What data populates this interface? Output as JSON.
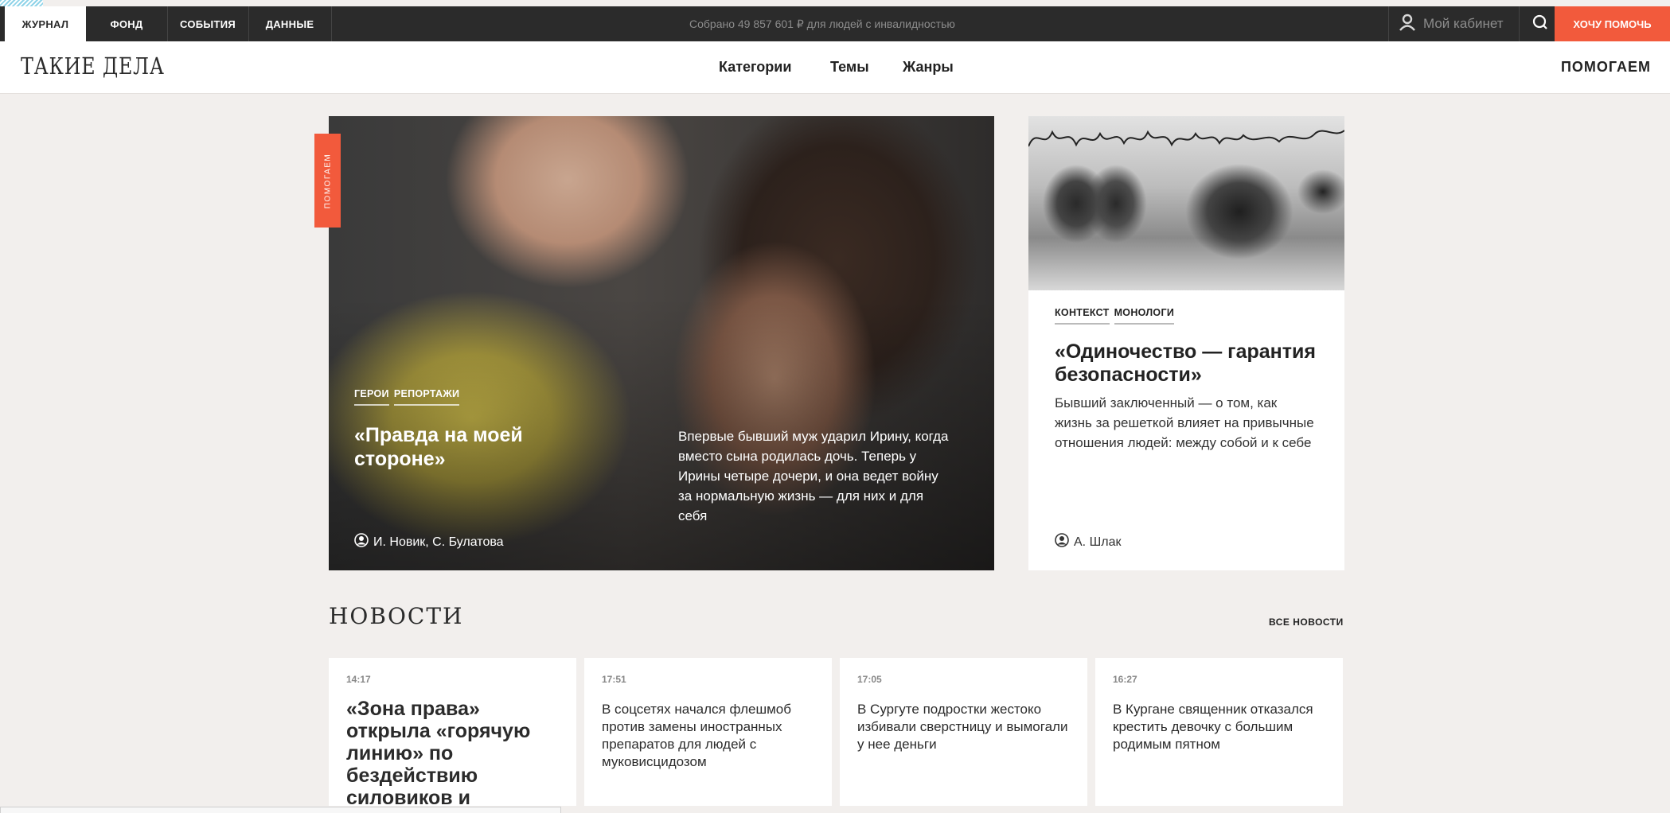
{
  "topbar": {
    "tabs": [
      {
        "label": "ЖУРНАЛ"
      },
      {
        "label": "ФОНД"
      },
      {
        "label": "СОБЫТИЯ"
      },
      {
        "label": "ДАННЫЕ"
      }
    ],
    "collected": "Собрано 49 857 601 ₽ для людей с инвалидностью",
    "cabinet": "Мой кабинет",
    "help_button": "ХОЧУ ПОМОЧЬ",
    "accent_color": "#f25a3c"
  },
  "header": {
    "logo": "ТАКИЕ ДЕЛА",
    "nav": [
      "Категории",
      "Темы",
      "Жанры"
    ],
    "right_link": "ПОМОГАЕМ"
  },
  "hero": {
    "flag": "ПОМОГАЕМ",
    "tags": [
      "ГЕРОИ",
      "РЕПОРТАЖИ"
    ],
    "title": "«Правда на моей стороне»",
    "lead": "Впервые бывший муж ударил Ирину, когда вместо сына родилась дочь. Теперь у Ирины четыре дочери, и она ведет войну за нормальную жизнь — для них и для себя",
    "author": "И. Новик, С. Булатова"
  },
  "side_article": {
    "tags": [
      "КОНТЕКСТ",
      "МОНОЛОГИ"
    ],
    "title": "«Одиночество — гарантия безопасности»",
    "lead": "Бывший заключенный — о том, как жизнь за решеткой влияет на привычные отношения людей: между собой и к себе",
    "author": "А. Шлак"
  },
  "news": {
    "heading": "НОВОСТИ",
    "all_link": "ВСЕ НОВОСТИ",
    "items": [
      {
        "time": "14:17",
        "text": "«Зона права» открыла «горячую линию» по бездействию силовиков и"
      },
      {
        "time": "17:51",
        "text": "В соцсетях начался флешмоб против замены иностранных препаратов для людей с муковисцидозом"
      },
      {
        "time": "17:05",
        "text": "В Сургуте подростки жестоко избивали сверстницу и вымогали у нее деньги"
      },
      {
        "time": "16:27",
        "text": "В Кургане священник отказался крестить девочку с большим родимым пятном"
      }
    ]
  }
}
